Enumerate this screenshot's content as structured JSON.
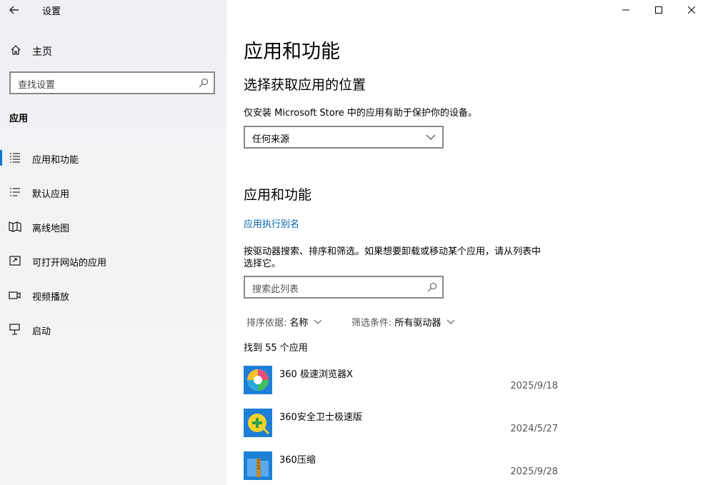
{
  "window": {
    "title": "设置",
    "controls": {
      "minimize": "minimize-icon",
      "maximize": "maximize-icon",
      "close": "close-icon"
    }
  },
  "sidebar": {
    "home_label": "主页",
    "search_placeholder": "查找设置",
    "section_title": "应用",
    "items": [
      {
        "label": "应用和功能",
        "icon": "apps-features-icon",
        "active": true
      },
      {
        "label": "默认应用",
        "icon": "default-apps-icon",
        "active": false
      },
      {
        "label": "离线地图",
        "icon": "offline-maps-icon",
        "active": false
      },
      {
        "label": "可打开网站的应用",
        "icon": "apps-for-websites-icon",
        "active": false
      },
      {
        "label": "视频播放",
        "icon": "video-playback-icon",
        "active": false
      },
      {
        "label": "启动",
        "icon": "startup-icon",
        "active": false
      }
    ]
  },
  "main": {
    "page_title": "应用和功能",
    "install_section": {
      "heading": "选择获取应用的位置",
      "description": "仅安装 Microsoft Store 中的应用有助于保护你的设备。",
      "dropdown_value": "任何来源"
    },
    "apps_section": {
      "heading": "应用和功能",
      "alias_link": "应用执行别名",
      "description_line1": "按驱动器搜索、排序和筛选。如果想要卸载或移动某个应用，请从列表中",
      "description_line2": "选择它。",
      "search_placeholder": "搜索此列表",
      "sort_label": "排序依据:",
      "sort_value": "名称",
      "filter_label": "筛选条件:",
      "filter_value": "所有驱动器",
      "count_text": "找到 55 个应用",
      "apps": [
        {
          "name": "360 极速浏览器X",
          "date": "2025/9/18",
          "icon": "360-browser-icon"
        },
        {
          "name": "360安全卫士极速版",
          "date": "2024/5/27",
          "icon": "360-security-icon"
        },
        {
          "name": "360压缩",
          "date": "2025/9/28",
          "icon": "360-zip-icon"
        }
      ]
    }
  },
  "colors": {
    "accent": "#0078d4",
    "link": "#0063b1",
    "sidebar_bg": "#f1f2f4"
  }
}
